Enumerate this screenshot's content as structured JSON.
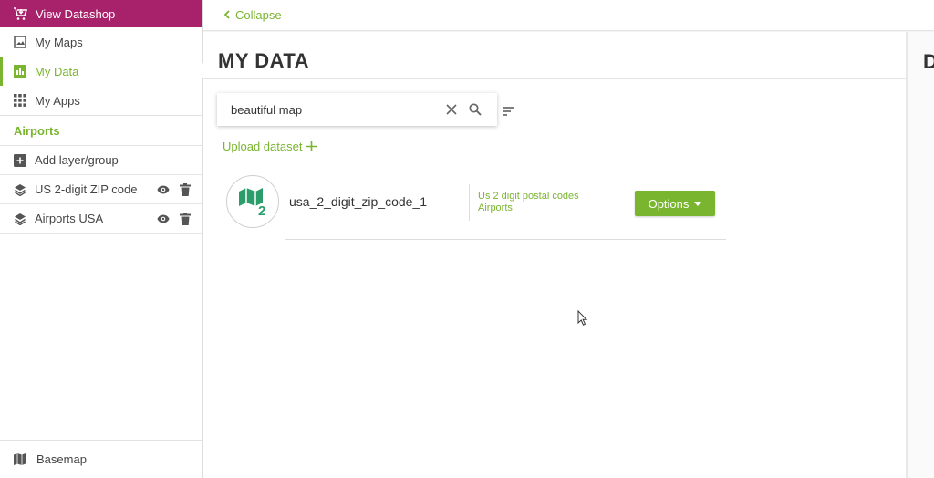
{
  "sidebar": {
    "datashop_label": "View Datashop",
    "nav": [
      {
        "label": "My Maps",
        "icon": "image-icon"
      },
      {
        "label": "My Data",
        "icon": "bar-chart-icon",
        "active": true
      },
      {
        "label": "My Apps",
        "icon": "apps-grid-icon"
      }
    ],
    "map_title": "Airports",
    "add_layer_label": "Add layer/group",
    "layers": [
      {
        "label": "US 2-digit ZIP code"
      },
      {
        "label": "Airports USA"
      }
    ],
    "basemap_label": "Basemap"
  },
  "topbar": {
    "collapse_label": "Collapse"
  },
  "main": {
    "title": "MY DATA",
    "search": {
      "value": "beautiful map"
    },
    "upload_label": "Upload dataset",
    "datasets": [
      {
        "name": "usa_2_digit_zip_code_1",
        "tags": [
          "Us 2 digit postal codes",
          "Airports"
        ],
        "options_label": "Options"
      }
    ]
  },
  "right_panel": {
    "title_fragment": "D"
  },
  "colors": {
    "accent": "#7ab530",
    "brand": "#a8216b",
    "icon_green": "#2a9d6a"
  }
}
